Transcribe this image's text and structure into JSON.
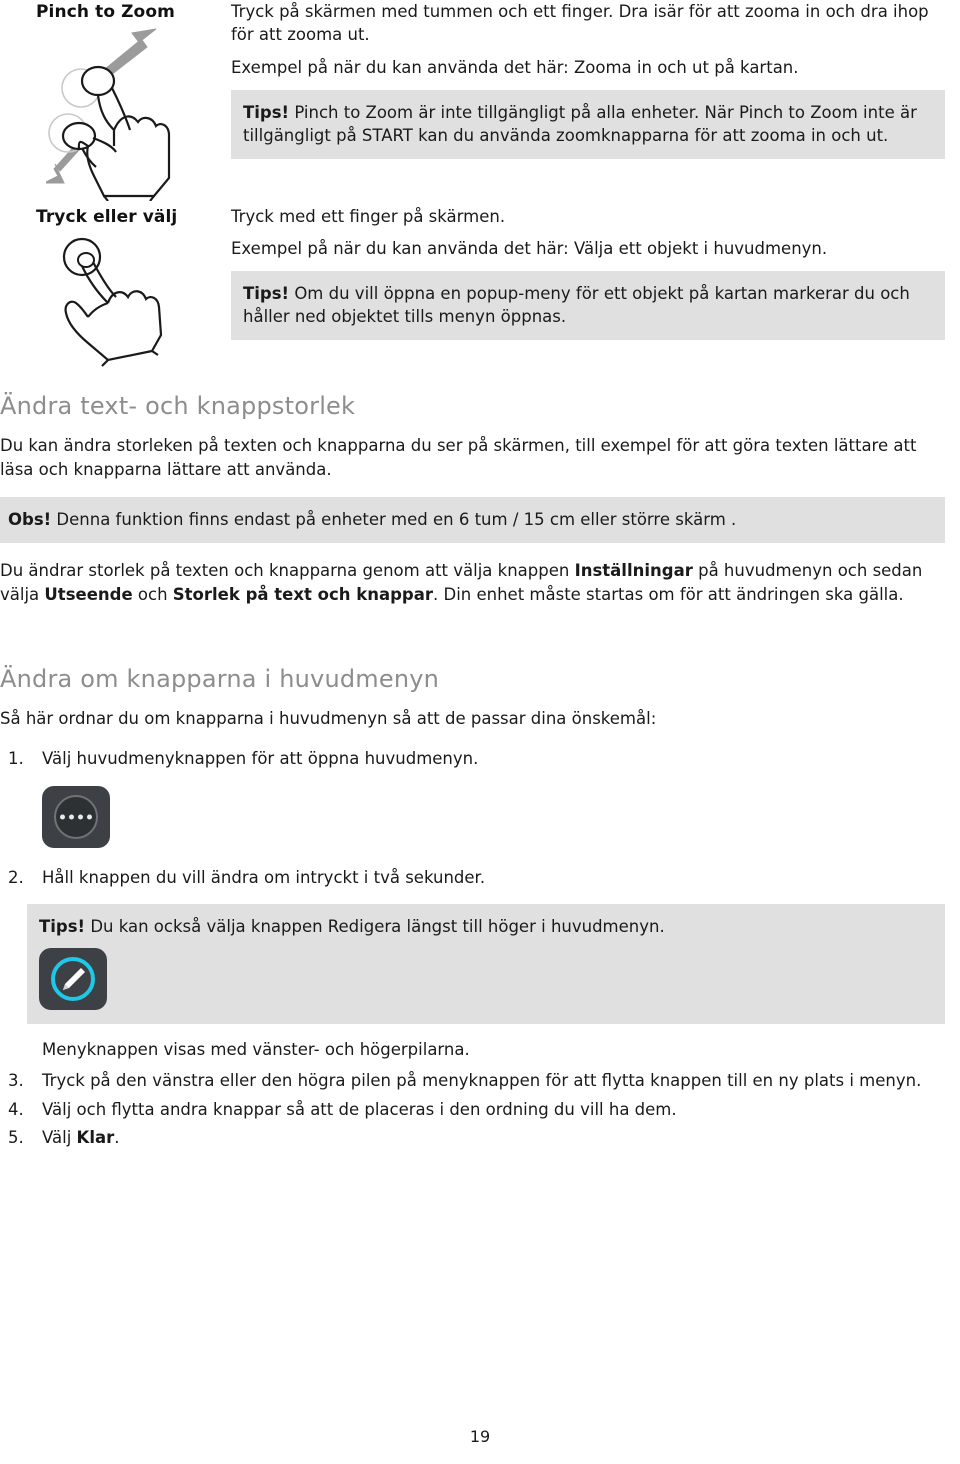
{
  "document": {
    "page_number": "19"
  },
  "gestures": [
    {
      "name": "Pinch to Zoom",
      "icon": "pinch-to-zoom-hand-illustration",
      "paragraphs": [
        "Tryck på skärmen med tummen och ett finger. Dra isär för att zooma in och dra ihop för att zooma ut.",
        "Exempel på när du kan använda det här: Zooma in och ut på kartan."
      ],
      "tip": {
        "lead": "Tips!",
        "text": " Pinch to Zoom är inte tillgängligt på alla enheter. När Pinch to Zoom inte är tillgängligt på START kan du använda zoomknapparna för att zooma in och ut."
      }
    },
    {
      "name": "Tryck eller välj",
      "icon": "tap-or-select-hand-illustration",
      "paragraphs": [
        "Tryck med ett finger på skärmen.",
        "Exempel på när du kan använda det här: Välja ett objekt i huvudmenyn."
      ],
      "tip": {
        "lead": "Tips!",
        "text": " Om du vill öppna en popup-meny för ett objekt på kartan markerar du och håller ned objektet tills menyn öppnas."
      }
    }
  ],
  "section_text_size": {
    "heading": "Ändra text- och knappstorlek",
    "intro": "Du kan ändra storleken på texten och knapparna du ser på skärmen, till exempel för att göra texten lättare att läsa och knapparna lättare att använda.",
    "note": {
      "lead": "Obs!",
      "text": " Denna funktion finns endast på enheter med en 6 tum / 15 cm eller större skärm ."
    },
    "after_note_parts": [
      {
        "text": "Du ändrar storlek på texten och knapparna genom att välja knappen ",
        "bold": false
      },
      {
        "text": "Inställningar",
        "bold": true
      },
      {
        "text": " på huvudmenyn och sedan välja ",
        "bold": false
      },
      {
        "text": "Utseende",
        "bold": true
      },
      {
        "text": " och ",
        "bold": false
      },
      {
        "text": "Storlek på text och knappar",
        "bold": true
      },
      {
        "text": ". Din enhet måste startas om för att ändringen ska gälla.",
        "bold": false
      }
    ]
  },
  "section_reorder": {
    "heading": "Ändra om knapparna i huvudmenyn",
    "intro": "Så här ordnar du om knapparna i huvudmenyn så att de passar dina önskemål:",
    "step1": {
      "num": "1.",
      "text": "Välj huvudmenyknappen för att öppna huvudmenyn."
    },
    "menu_button_icon": "main-menu-button-icon",
    "step2": {
      "num": "2.",
      "text": "Håll knappen du vill ändra om intryckt i två sekunder."
    },
    "tip": {
      "lead": "Tips!",
      "text": " Du kan också välja knappen Redigera längst till höger i huvudmenyn.",
      "icon": "edit-pencil-button-icon"
    },
    "after_tip": "Menyknappen visas med vänster- och högerpilarna.",
    "step3": {
      "num": "3.",
      "text": "Tryck på den vänstra eller den högra pilen på menyknappen för att flytta knappen till en ny plats i menyn."
    },
    "step4": {
      "num": "4.",
      "text": "Välj och flytta andra knappar så att de placeras i den ordning du vill ha dem."
    },
    "step5": {
      "num": "5.",
      "prefix": "Välj ",
      "bold": "Klar",
      "suffix": "."
    }
  },
  "colors": {
    "tip_background": "#e0e0e0",
    "heading_gray": "#8d8d8d",
    "button_dark": "#3d4145",
    "accent_cyan": "#1ec8e6"
  }
}
